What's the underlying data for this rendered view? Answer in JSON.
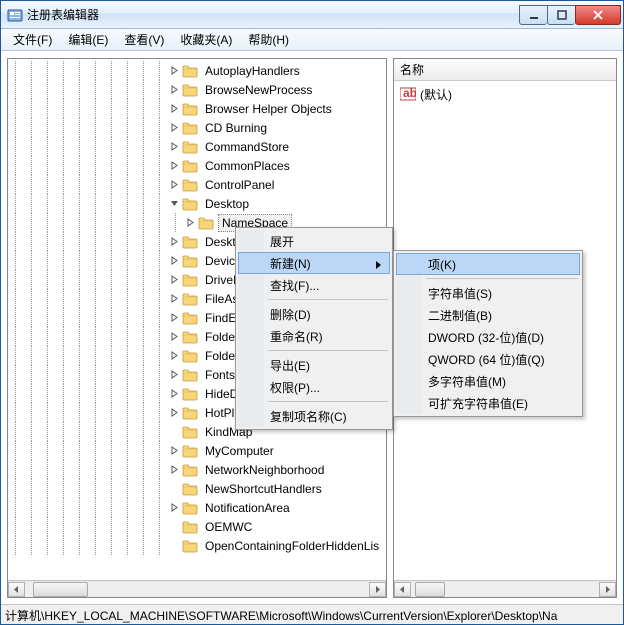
{
  "window": {
    "title": "注册表编辑器"
  },
  "menubar": {
    "file": "文件(F)",
    "edit": "编辑(E)",
    "view": "查看(V)",
    "favorites": "收藏夹(A)",
    "help": "帮助(H)"
  },
  "tree": {
    "items": [
      {
        "label": "AutoplayHandlers",
        "expandable": true
      },
      {
        "label": "BrowseNewProcess",
        "expandable": true
      },
      {
        "label": "Browser Helper Objects",
        "expandable": true
      },
      {
        "label": "CD Burning",
        "expandable": true
      },
      {
        "label": "CommandStore",
        "expandable": true
      },
      {
        "label": "CommonPlaces",
        "expandable": true
      },
      {
        "label": "ControlPanel",
        "expandable": true
      },
      {
        "label": "Desktop",
        "expandable": true,
        "expanded": true,
        "children": [
          {
            "label": "NameSpace",
            "expandable": true,
            "selected": true
          }
        ]
      },
      {
        "label": "DesktopI",
        "expandable": true
      },
      {
        "label": "DeviceUp",
        "expandable": true
      },
      {
        "label": "DriveIcon",
        "expandable": true
      },
      {
        "label": "FileAssoc",
        "expandable": true
      },
      {
        "label": "FindExten",
        "expandable": true
      },
      {
        "label": "FolderDe",
        "expandable": true
      },
      {
        "label": "FolderTyp",
        "expandable": true
      },
      {
        "label": "FontsFold",
        "expandable": true
      },
      {
        "label": "HideDesk",
        "expandable": true
      },
      {
        "label": "HotPlugN",
        "expandable": true
      },
      {
        "label": "KindMap",
        "expandable": false
      },
      {
        "label": "MyComputer",
        "expandable": true
      },
      {
        "label": "NetworkNeighborhood",
        "expandable": true
      },
      {
        "label": "NewShortcutHandlers",
        "expandable": false
      },
      {
        "label": "NotificationArea",
        "expandable": true
      },
      {
        "label": "OEMWC",
        "expandable": false
      },
      {
        "label": "OpenContainingFolderHiddenLis",
        "expandable": false
      }
    ]
  },
  "list": {
    "header_name": "名称",
    "rows": [
      {
        "icon": "ab",
        "label": "(默认)"
      }
    ]
  },
  "context_menu": {
    "expand": "展开",
    "new": "新建(N)",
    "find": "查找(F)...",
    "delete": "删除(D)",
    "rename": "重命名(R)",
    "export": "导出(E)",
    "permissions": "权限(P)...",
    "copy_key_name": "复制项名称(C)"
  },
  "submenu_new": {
    "key": "项(K)",
    "string": "字符串值(S)",
    "binary": "二进制值(B)",
    "dword": "DWORD (32-位)值(D)",
    "qword": "QWORD (64 位)值(Q)",
    "multi": "多字符串值(M)",
    "expand": "可扩充字符串值(E)"
  },
  "statusbar": {
    "path": "计算机\\HKEY_LOCAL_MACHINE\\SOFTWARE\\Microsoft\\Windows\\CurrentVersion\\Explorer\\Desktop\\Na"
  }
}
